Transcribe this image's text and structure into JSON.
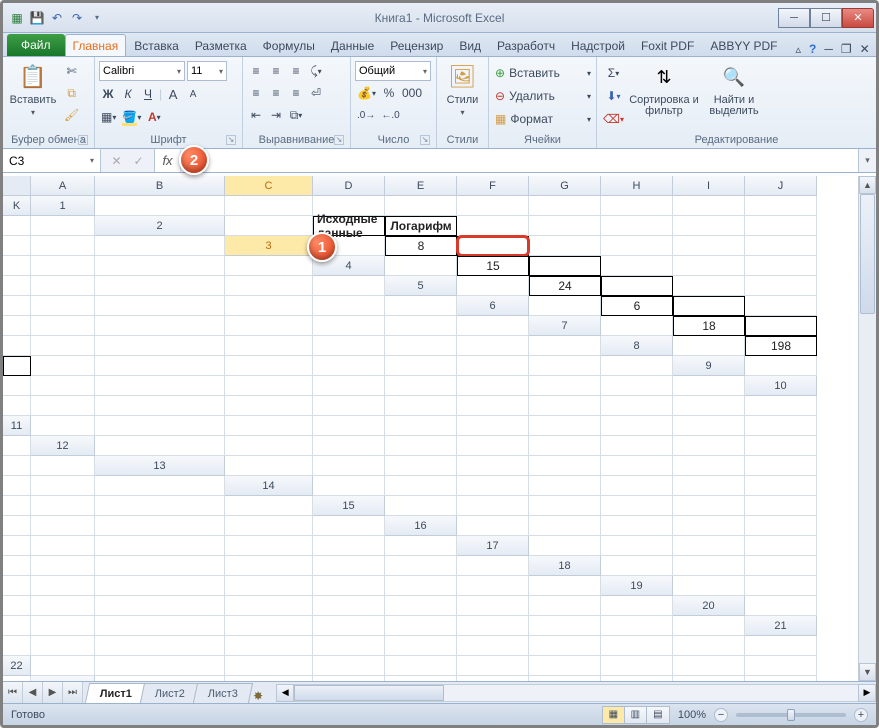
{
  "window": {
    "title": "Книга1  -  Microsoft Excel"
  },
  "qat": {
    "excel_icon": "⊞",
    "save_icon": "💾",
    "undo_icon": "↶",
    "redo_icon": "↷"
  },
  "tabs": {
    "file": "Файл",
    "items": [
      "Главная",
      "Вставка",
      "Разметка",
      "Формулы",
      "Данные",
      "Рецензир",
      "Вид",
      "Разработч",
      "Надстрой",
      "Foxit PDF",
      "ABBYY PDF"
    ],
    "active_index": 0
  },
  "ribbon": {
    "clipboard": {
      "paste": "Вставить",
      "label": "Буфер обмена"
    },
    "font": {
      "label": "Шрифт",
      "name": "Calibri",
      "size": "11",
      "bold": "Ж",
      "italic": "К",
      "underline": "Ч"
    },
    "alignment": {
      "label": "Выравнивание"
    },
    "number": {
      "label": "Число",
      "format": "Общий"
    },
    "styles": {
      "label": "Стили",
      "btn": "Стили"
    },
    "cells": {
      "label": "Ячейки",
      "insert": "Вставить",
      "delete": "Удалить",
      "format": "Формат"
    },
    "editing": {
      "label": "Редактирование",
      "sort": "Сортировка и фильтр",
      "find": "Найти и выделить"
    }
  },
  "formula_bar": {
    "namebox": "C3",
    "fx": "fx",
    "value": ""
  },
  "sheet": {
    "columns": [
      "A",
      "B",
      "C",
      "D",
      "E",
      "F",
      "G",
      "H",
      "I",
      "J",
      "K"
    ],
    "active_col": "C",
    "active_row": 3,
    "rows_shown": 23,
    "headers": {
      "b": "Исходные данные",
      "c": "Логарифм"
    },
    "data_b": [
      "8",
      "15",
      "24",
      "6",
      "18",
      "198"
    ]
  },
  "sheet_tabs": {
    "items": [
      "Лист1",
      "Лист2",
      "Лист3"
    ],
    "active_index": 0
  },
  "status": {
    "ready": "Готово",
    "zoom": "100%"
  },
  "callouts": {
    "one": "1",
    "two": "2"
  }
}
